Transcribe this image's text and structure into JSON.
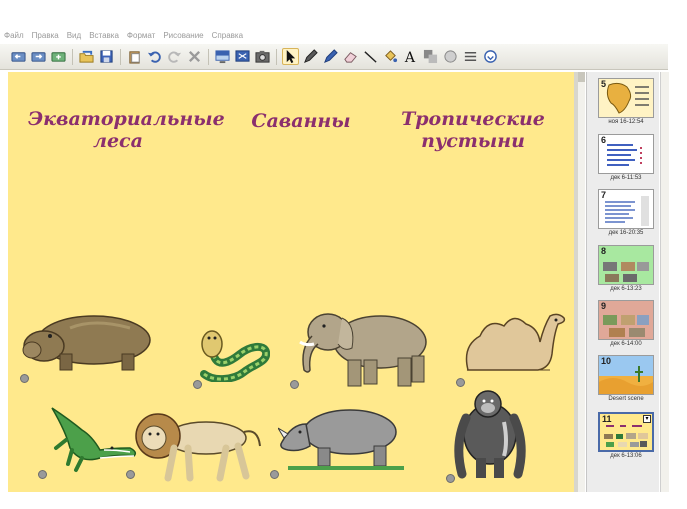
{
  "menu": [
    "Файл",
    "Правка",
    "Вид",
    "Вставка",
    "Формат",
    "Рисование",
    "Справка"
  ],
  "headings": [
    {
      "line1": "Экваториальные",
      "line2": "леса"
    },
    {
      "line1": "Саванны",
      "line2": ""
    },
    {
      "line1": "Тропические",
      "line2": "пустыни"
    }
  ],
  "toolbar_icons": [
    "back-icon",
    "forward-icon",
    "add-page-icon",
    "open-icon",
    "save-icon",
    "paste-icon",
    "undo-icon",
    "redo-icon",
    "delete-icon",
    "screen-shade-icon",
    "full-screen-icon",
    "camera-icon",
    "select-icon",
    "pen-icon",
    "creative-pen-icon",
    "eraser-icon",
    "line-icon",
    "fill-icon",
    "text-icon",
    "shapes-icon",
    "magic-pen-icon",
    "properties-icon",
    "more-icon"
  ],
  "slides": [
    {
      "number": "5",
      "caption": "ноя 16-12:54"
    },
    {
      "number": "6",
      "caption": "дек 6-11:53"
    },
    {
      "number": "7",
      "caption": "дек 16-20:35"
    },
    {
      "number": "8",
      "caption": "дек 6-13:23"
    },
    {
      "number": "9",
      "caption": "дек 6-14:00"
    },
    {
      "number": "10",
      "caption": "Desert scene"
    },
    {
      "number": "11",
      "caption": "дек 6-13:06"
    }
  ],
  "colors": {
    "canvas": "#ffe98c",
    "heading": "#8b2f6e"
  }
}
